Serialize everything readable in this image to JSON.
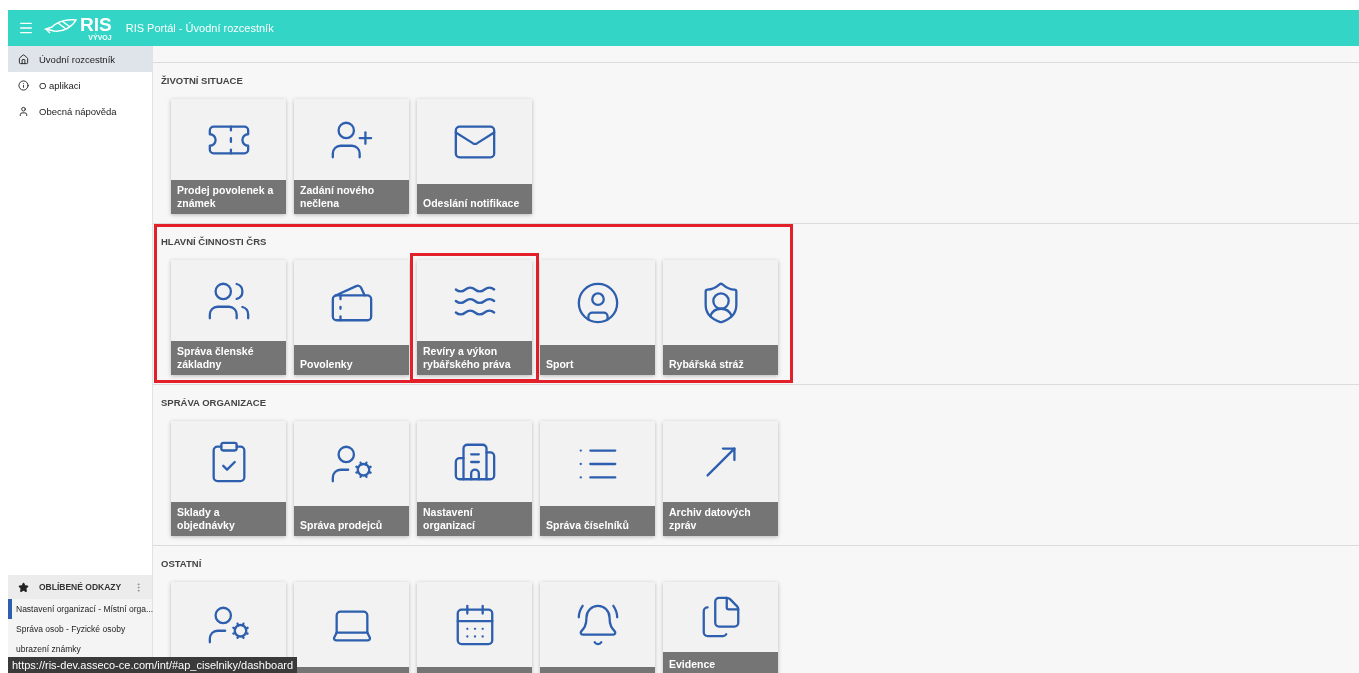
{
  "header": {
    "logo": {
      "name": "RIS",
      "env": "VÝVOJ"
    },
    "title": "RIS Portál - Úvodní rozcestník"
  },
  "sidebar": {
    "items": [
      {
        "label": "Úvodní rozcestník",
        "selected": true
      },
      {
        "label": "O aplikaci",
        "selected": false
      },
      {
        "label": "Obecná nápověda",
        "selected": false
      }
    ]
  },
  "favorites": {
    "title": "OBLÍBENÉ ODKAZY",
    "items": [
      {
        "label": "Nastavení organizací - Místní orga...",
        "selected": true
      },
      {
        "label": "Správa osob - Fyzické osoby",
        "selected": false
      },
      {
        "label": "ubrazení známky",
        "selected": false
      }
    ]
  },
  "sections": [
    {
      "title": "ŽIVOTNÍ SITUACE",
      "highlighted": false,
      "tiles": [
        {
          "label": "Prodej povolenek a známek",
          "highlighted": false
        },
        {
          "label": "Zadání nového nečlena",
          "highlighted": false
        },
        {
          "label": "Odeslání notifikace",
          "highlighted": false
        }
      ]
    },
    {
      "title": "HLAVNÍ ČINNOSTI ČRS",
      "highlighted": true,
      "tiles": [
        {
          "label": "Správa členské základny",
          "highlighted": false
        },
        {
          "label": "Povolenky",
          "highlighted": false
        },
        {
          "label": "Revíry a výkon rybářského práva",
          "highlighted": true
        },
        {
          "label": "Sport",
          "highlighted": false
        },
        {
          "label": "Rybářská stráž",
          "highlighted": false
        }
      ]
    },
    {
      "title": "SPRÁVA ORGANIZACE",
      "highlighted": false,
      "tiles": [
        {
          "label": "Sklady a objednávky",
          "highlighted": false
        },
        {
          "label": "Správa prodejců",
          "highlighted": false
        },
        {
          "label": "Nastavení organizací",
          "highlighted": false
        },
        {
          "label": "Správa číselníků",
          "highlighted": false
        },
        {
          "label": "Archiv datových zpráv",
          "highlighted": false
        }
      ]
    },
    {
      "title": "OSTATNÍ",
      "highlighted": false,
      "tiles": [
        {
          "highlighted": false
        },
        {
          "highlighted": false
        },
        {
          "highlighted": false
        },
        {
          "highlighted": false
        },
        {
          "label": "Evidence",
          "label_cut": true,
          "highlighted": false
        }
      ]
    }
  ],
  "status_url": "https://ris-dev.asseco-ce.com/int/#ap_ciselniky/dashboard"
}
